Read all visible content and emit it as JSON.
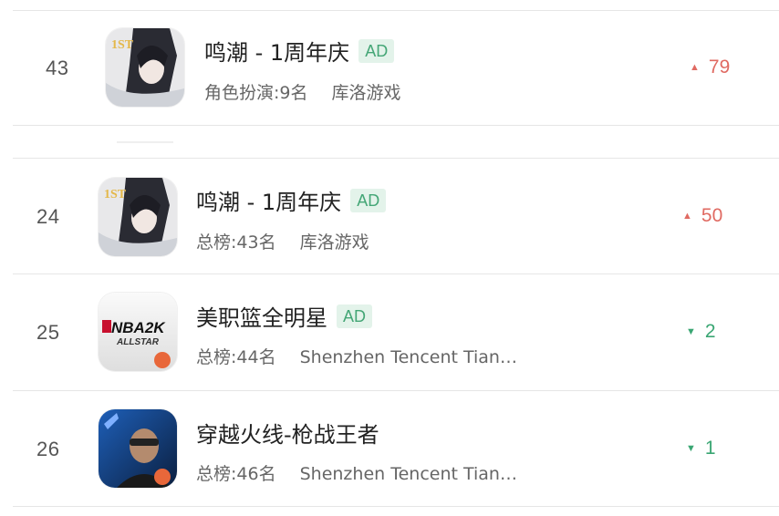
{
  "rows": [
    {
      "rank": "43",
      "name": "鸣潮 - 1周年庆",
      "ad": "AD",
      "category_rank": "角色扮演:9名",
      "developer": "库洛游戏",
      "trend_direction": "up",
      "trend_arrow": "▲",
      "trend_value": "79",
      "icon": "wuthering-waves-app-icon"
    },
    {
      "rank": "24",
      "name": "鸣潮 - 1周年庆",
      "ad": "AD",
      "category_rank": "总榜:43名",
      "developer": "库洛游戏",
      "trend_direction": "up",
      "trend_arrow": "▲",
      "trend_value": "50",
      "icon": "wuthering-waves-app-icon"
    },
    {
      "rank": "25",
      "name": "美职篮全明星",
      "ad": "AD",
      "category_rank": "总榜:44名",
      "developer": "Shenzhen Tencent Tian…",
      "trend_direction": "down",
      "trend_arrow": "▼",
      "trend_value": "2",
      "icon": "nba2k-allstar-app-icon"
    },
    {
      "rank": "26",
      "name": "穿越火线-枪战王者",
      "ad": "",
      "category_rank": "总榜:46名",
      "developer": "Shenzhen Tencent Tian…",
      "trend_direction": "down",
      "trend_arrow": "▼",
      "trend_value": "1",
      "icon": "crossfire-app-icon"
    }
  ],
  "icon_text": {
    "first": "1ST",
    "nba": "NBA2K",
    "allstar": "ALLSTAR"
  },
  "colors": {
    "up": "#e06a62",
    "down": "#3aa673",
    "ad_text": "#44a676",
    "ad_bg": "#e3f3ea"
  }
}
